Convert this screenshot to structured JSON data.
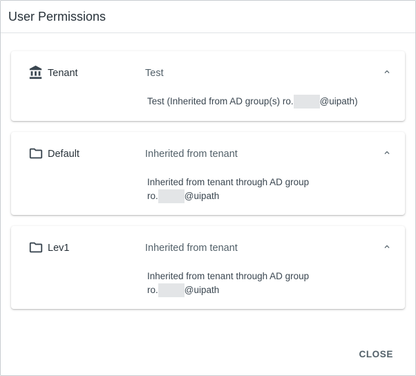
{
  "dialog": {
    "title": "User Permissions",
    "close_label": "CLOSE"
  },
  "panels": [
    {
      "name": "Tenant",
      "icon": "bank-icon",
      "summary": "Test",
      "detail_line1_prefix": "Test (Inherited from AD group(s) ro.",
      "detail_line1_suffix": "@uipath)"
    },
    {
      "name": "Default",
      "icon": "folder-icon",
      "summary": "Inherited from tenant",
      "detail_line1": "Inherited from tenant through AD group",
      "detail_line2_prefix": "ro.",
      "detail_line2_suffix": "@uipath"
    },
    {
      "name": "Lev1",
      "icon": "folder-icon",
      "summary": "Inherited from tenant",
      "detail_line1": "Inherited from tenant through AD group",
      "detail_line2_prefix": "ro.",
      "detail_line2_suffix": "@uipath"
    }
  ],
  "colors": {
    "title": "#273139",
    "text": "#526069",
    "divider": "#dfe3e6",
    "redaction": "#e3e5e7"
  }
}
